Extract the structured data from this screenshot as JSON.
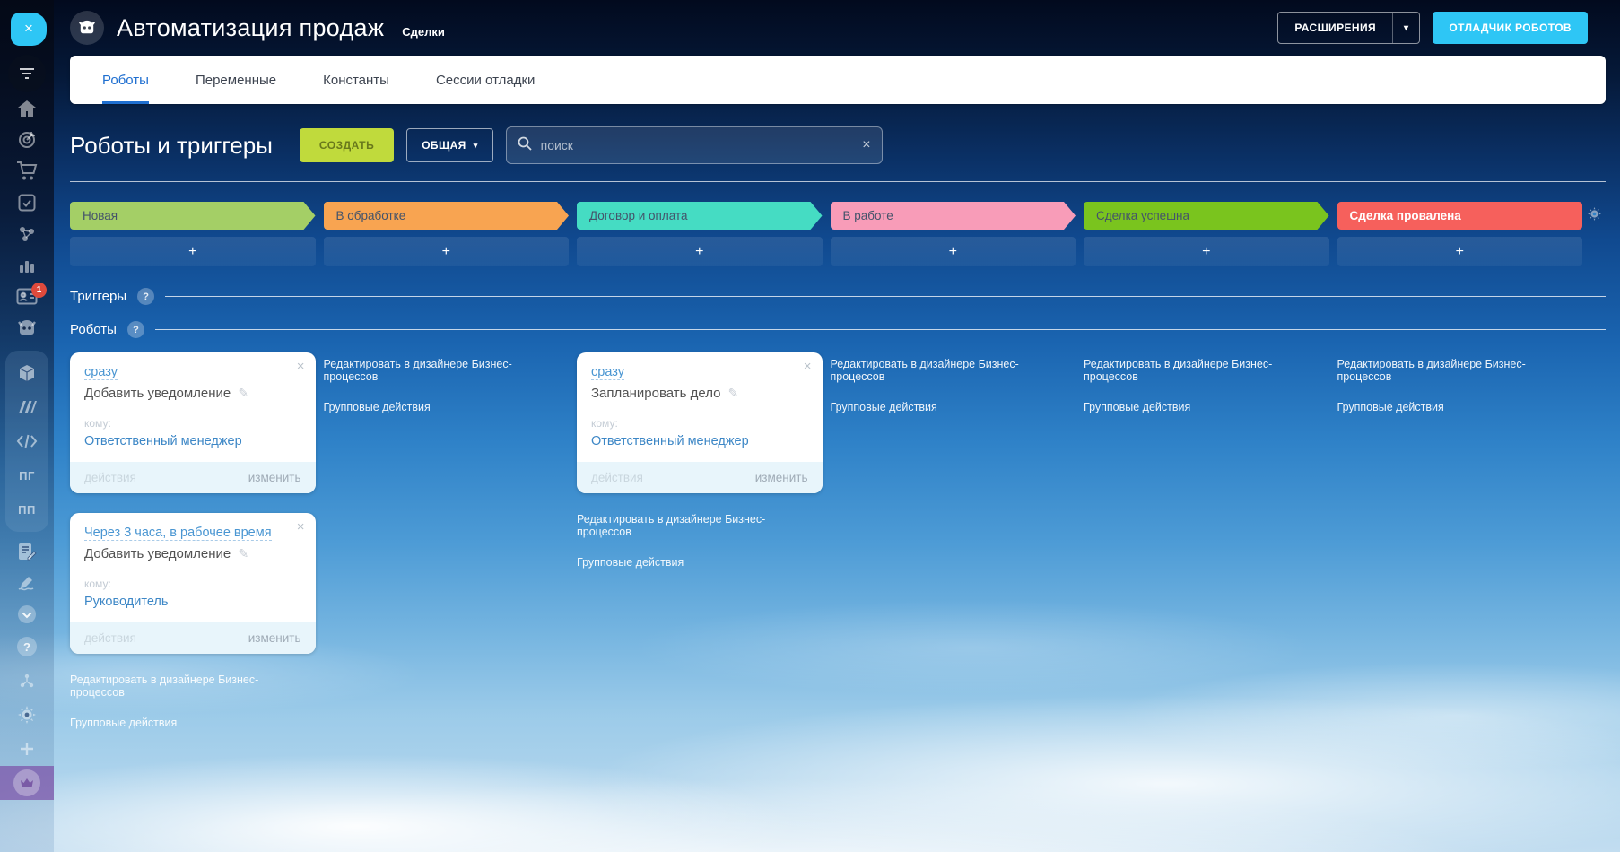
{
  "sidebar": {
    "close_label": "×",
    "contacts_badge": "1",
    "pg_label": "ПГ",
    "pp_label": "ПП",
    "help_label": "?"
  },
  "header": {
    "title": "Автоматизация продаж",
    "breadcrumb": "Сделки",
    "extensions_button": "РАСШИРЕНИЯ",
    "debugger_button": "ОТЛАДЧИК РОБОТОВ"
  },
  "tabs": [
    {
      "label": "Роботы"
    },
    {
      "label": "Переменные"
    },
    {
      "label": "Константы"
    },
    {
      "label": "Сессии отладки"
    }
  ],
  "toolbar": {
    "page_title": "Роботы и триггеры",
    "create_button": "СОЗДАТЬ",
    "funnel_button": "ОБЩАЯ",
    "search_placeholder": "поиск",
    "clear_label": "×"
  },
  "stages": [
    {
      "label": "Новая",
      "color": "#a4cf66"
    },
    {
      "label": "В обработке",
      "color": "#f8a451"
    },
    {
      "label": "Договор и оплата",
      "color": "#45dcc3"
    },
    {
      "label": "В работе",
      "color": "#f89cb8"
    },
    {
      "label": "Сделка успешна",
      "color": "#7ac41e"
    },
    {
      "label": "Сделка провалена",
      "color": "#f6605c"
    }
  ],
  "add_label": "+",
  "sections": {
    "triggers": "Триггеры",
    "robots": "Роботы"
  },
  "icons": {
    "pencil": "✎",
    "caret": "▾"
  },
  "card_footer": {
    "actions": "действия",
    "edit": "изменить"
  },
  "common_links": {
    "designer": "Редактировать в дизайнере Бизнес-процессов",
    "group": "Групповые действия"
  },
  "cards": {
    "c1": {
      "trigger": "сразу",
      "action": "Добавить уведомление",
      "to": "кому:",
      "recipient": "Ответственный менеджер",
      "close": "×"
    },
    "c2": {
      "trigger": "Через 3 часа, в рабочее время",
      "action": "Добавить уведомление",
      "to": "кому:",
      "recipient": "Руководитель",
      "close": "×"
    },
    "c3": {
      "trigger": "сразу",
      "action": "Запланировать дело",
      "to": "кому:",
      "recipient": "Ответственный менеджер",
      "close": "×"
    }
  }
}
